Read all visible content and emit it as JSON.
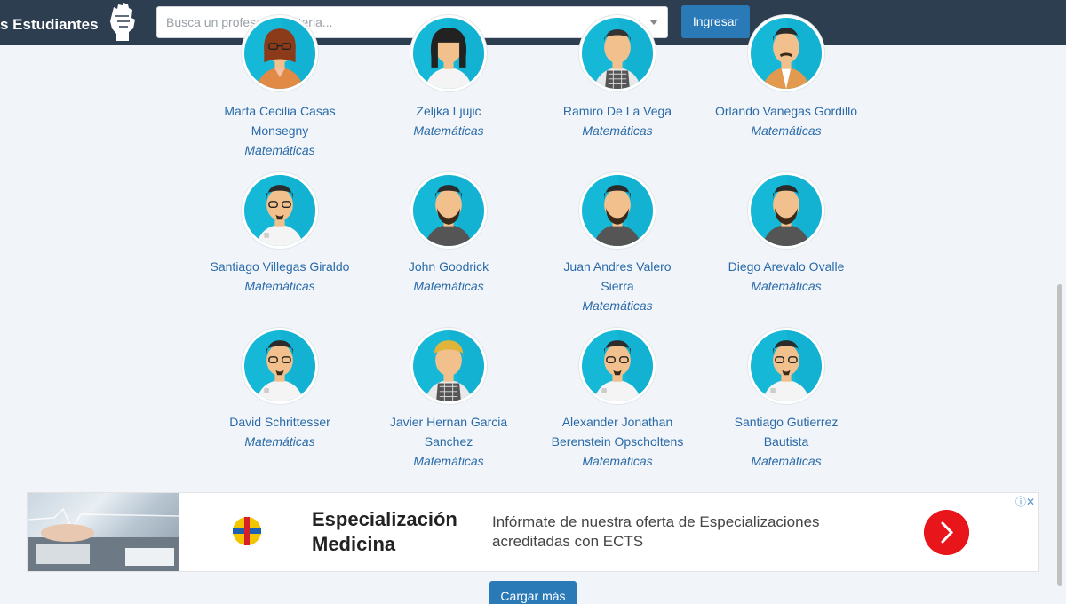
{
  "header": {
    "brand": "s Estudiantes",
    "search_placeholder": "Busca un profesor o materia...",
    "login_label": "Ingresar"
  },
  "teachers": [
    {
      "name_lines": [
        "Marta Cecilia Casas",
        "Monsegny"
      ],
      "subject": "Matemáticas"
    },
    {
      "name_lines": [
        "Zeljka Ljujic"
      ],
      "subject": "Matemáticas"
    },
    {
      "name_lines": [
        "Ramiro De La Vega"
      ],
      "subject": "Matemáticas"
    },
    {
      "name_lines": [
        "Orlando Vanegas Gordillo"
      ],
      "subject": "Matemáticas"
    },
    {
      "name_lines": [
        "Santiago Villegas Giraldo"
      ],
      "subject": "Matemáticas"
    },
    {
      "name_lines": [
        "John Goodrick"
      ],
      "subject": "Matemáticas"
    },
    {
      "name_lines": [
        "Juan Andres Valero",
        "Sierra"
      ],
      "subject": "Matemáticas"
    },
    {
      "name_lines": [
        "Diego Arevalo Ovalle"
      ],
      "subject": "Matemáticas"
    },
    {
      "name_lines": [
        "David Schrittesser"
      ],
      "subject": "Matemáticas"
    },
    {
      "name_lines": [
        "Javier Hernan Garcia",
        "Sanchez"
      ],
      "subject": "Matemáticas"
    },
    {
      "name_lines": [
        "Alexander Jonathan",
        "Berenstein Opscholtens"
      ],
      "subject": "Matemáticas"
    },
    {
      "name_lines": [
        "Santiago Gutierrez",
        "Bautista"
      ],
      "subject": "Matemáticas"
    }
  ],
  "ad": {
    "title_lines": [
      "Especialización",
      "Medicina"
    ],
    "text_lines": [
      "Infórmate de nuestra oferta de Especializaciones",
      "acreditadas con ECTS"
    ],
    "info_label": "ⓘ✕"
  },
  "load_more_label": "Cargar más"
}
